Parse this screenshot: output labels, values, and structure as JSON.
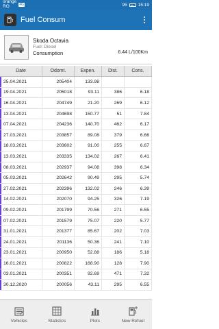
{
  "status": {
    "carrier_line1": "orange",
    "carrier_line2": "RO",
    "network": "4G",
    "time": "15:19",
    "battery": "95"
  },
  "appbar": {
    "title": "Fuel Consum"
  },
  "vehicle": {
    "name": "Skoda Octavia",
    "fuel": "Fuel: Diesel",
    "consumption_label": "Consumption",
    "consumption_value": "6.44 L/100Km"
  },
  "table": {
    "headers": [
      "Date",
      "Odomt.",
      "Expen.",
      "Dist.",
      "Cons."
    ],
    "rows": [
      [
        "25.04.2021",
        "205404",
        "133.98",
        "",
        ""
      ],
      [
        "19.04.2021",
        "205018",
        "93.11",
        "386",
        "6.18"
      ],
      [
        "16.04.2021",
        "204749",
        "21.20",
        "269",
        "6.12"
      ],
      [
        "13.04.2021",
        "204698",
        "150.77",
        "51",
        "7.84"
      ],
      [
        "07.04.2021",
        "204236",
        "140.70",
        "462",
        "6.17"
      ],
      [
        "27.03.2021",
        "203857",
        "89.08",
        "379",
        "6.66"
      ],
      [
        "18.03.2021",
        "203602",
        "91.00",
        "255",
        "6.67"
      ],
      [
        "13.03.2021",
        "203335",
        "134.02",
        "267",
        "6.41"
      ],
      [
        "08.03.2021",
        "202937",
        "94.08",
        "398",
        "6.34"
      ],
      [
        "05.03.2021",
        "202642",
        "90.49",
        "295",
        "5.74"
      ],
      [
        "27.02.2021",
        "202396",
        "132.02",
        "246",
        "6.39"
      ],
      [
        "14.02.2021",
        "202070",
        "94.25",
        "326",
        "7.19"
      ],
      [
        "09.02.2021",
        "201799",
        "70.56",
        "271",
        "6.55"
      ],
      [
        "07.02.2021",
        "201579",
        "75.07",
        "220",
        "5.77"
      ],
      [
        "31.01.2021",
        "201377",
        "85.67",
        "202",
        "7.03"
      ],
      [
        "24.01.2021",
        "201136",
        "50.36",
        "241",
        "7.10"
      ],
      [
        "23.01.2021",
        "200950",
        "52.88",
        "186",
        "5.18"
      ],
      [
        "16.01.2021",
        "200822",
        "168.90",
        "128",
        "7.90"
      ],
      [
        "03.01.2021",
        "200351",
        "92.69",
        "471",
        "7.32"
      ],
      [
        "30.12.2020",
        "200056",
        "43.11",
        "295",
        "6.55"
      ]
    ]
  },
  "nav": [
    {
      "label": "Vehicles",
      "icon": "vehicles-icon"
    },
    {
      "label": "Statistics",
      "icon": "statistics-icon"
    },
    {
      "label": "Plots",
      "icon": "plots-icon"
    },
    {
      "label": "New Refuel",
      "icon": "new-refuel-icon"
    }
  ],
  "colors": {
    "primary": "#1e72b6",
    "status_bar": "#1c6fb2",
    "row_accent": "#6b40d6",
    "header_bg": "#e8e8e8",
    "nav_bg": "#eeeeee"
  }
}
